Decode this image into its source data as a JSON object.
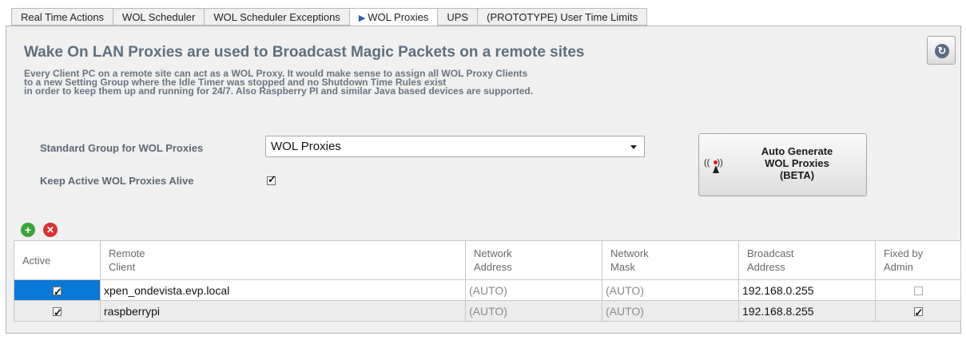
{
  "tabs": [
    {
      "label": "Real Time Actions",
      "active": false
    },
    {
      "label": "WOL Scheduler",
      "active": false
    },
    {
      "label": "WOL Scheduler Exceptions",
      "active": false
    },
    {
      "label": "WOL Proxies",
      "active": true
    },
    {
      "label": "UPS",
      "active": false
    },
    {
      "label": "(PROTOTYPE) User Time Limits",
      "active": false
    }
  ],
  "header": {
    "title": "Wake On LAN Proxies are used to Broadcast Magic Packets on a remote sites",
    "description_lines": [
      "Every Client PC on a remote site can act as a WOL Proxy. It would make sense to assign all WOL Proxy Clients",
      "to a new Setting Group where the Idle Timer was stopped and no Shutdown Time Rules exist",
      "in order to keep them up and running for 24/7. Also Raspberry PI and similar Java based devices are supported."
    ]
  },
  "settings": {
    "standard_group_label": "Standard Group for WOL Proxies",
    "standard_group_value": "WOL Proxies",
    "keep_alive_label": "Keep Active WOL Proxies Alive",
    "keep_alive_checked": true
  },
  "auto_generate_button": {
    "label_lines": [
      "Auto Generate",
      "WOL Proxies",
      "(BETA)"
    ],
    "icon": "wireless-tower-icon"
  },
  "toolbar": {
    "add_icon": "plus-circle-icon",
    "delete_icon": "x-circle-icon"
  },
  "table": {
    "columns": [
      {
        "line1": "Active",
        "line2": ""
      },
      {
        "line1": "Remote",
        "line2": "Client"
      },
      {
        "line1": "Network",
        "line2": "Address"
      },
      {
        "line1": "Network",
        "line2": "Mask"
      },
      {
        "line1": "Broadcast",
        "line2": "Address"
      },
      {
        "line1": "Fixed by",
        "line2": "Admin"
      }
    ],
    "rows": [
      {
        "active": true,
        "client": "xpen_ondevista.evp.local",
        "network_address": "(AUTO)",
        "network_mask": "(AUTO)",
        "broadcast": "192.168.0.255",
        "fixed": false,
        "selected": true
      },
      {
        "active": true,
        "client": "raspberrypi",
        "network_address": "(AUTO)",
        "network_mask": "(AUTO)",
        "broadcast": "192.168.8.255",
        "fixed": true,
        "selected": false
      }
    ]
  },
  "colors": {
    "selection": "#0a78d7",
    "title": "#5f6f7f",
    "add": "#3aa538",
    "delete": "#d93131"
  }
}
